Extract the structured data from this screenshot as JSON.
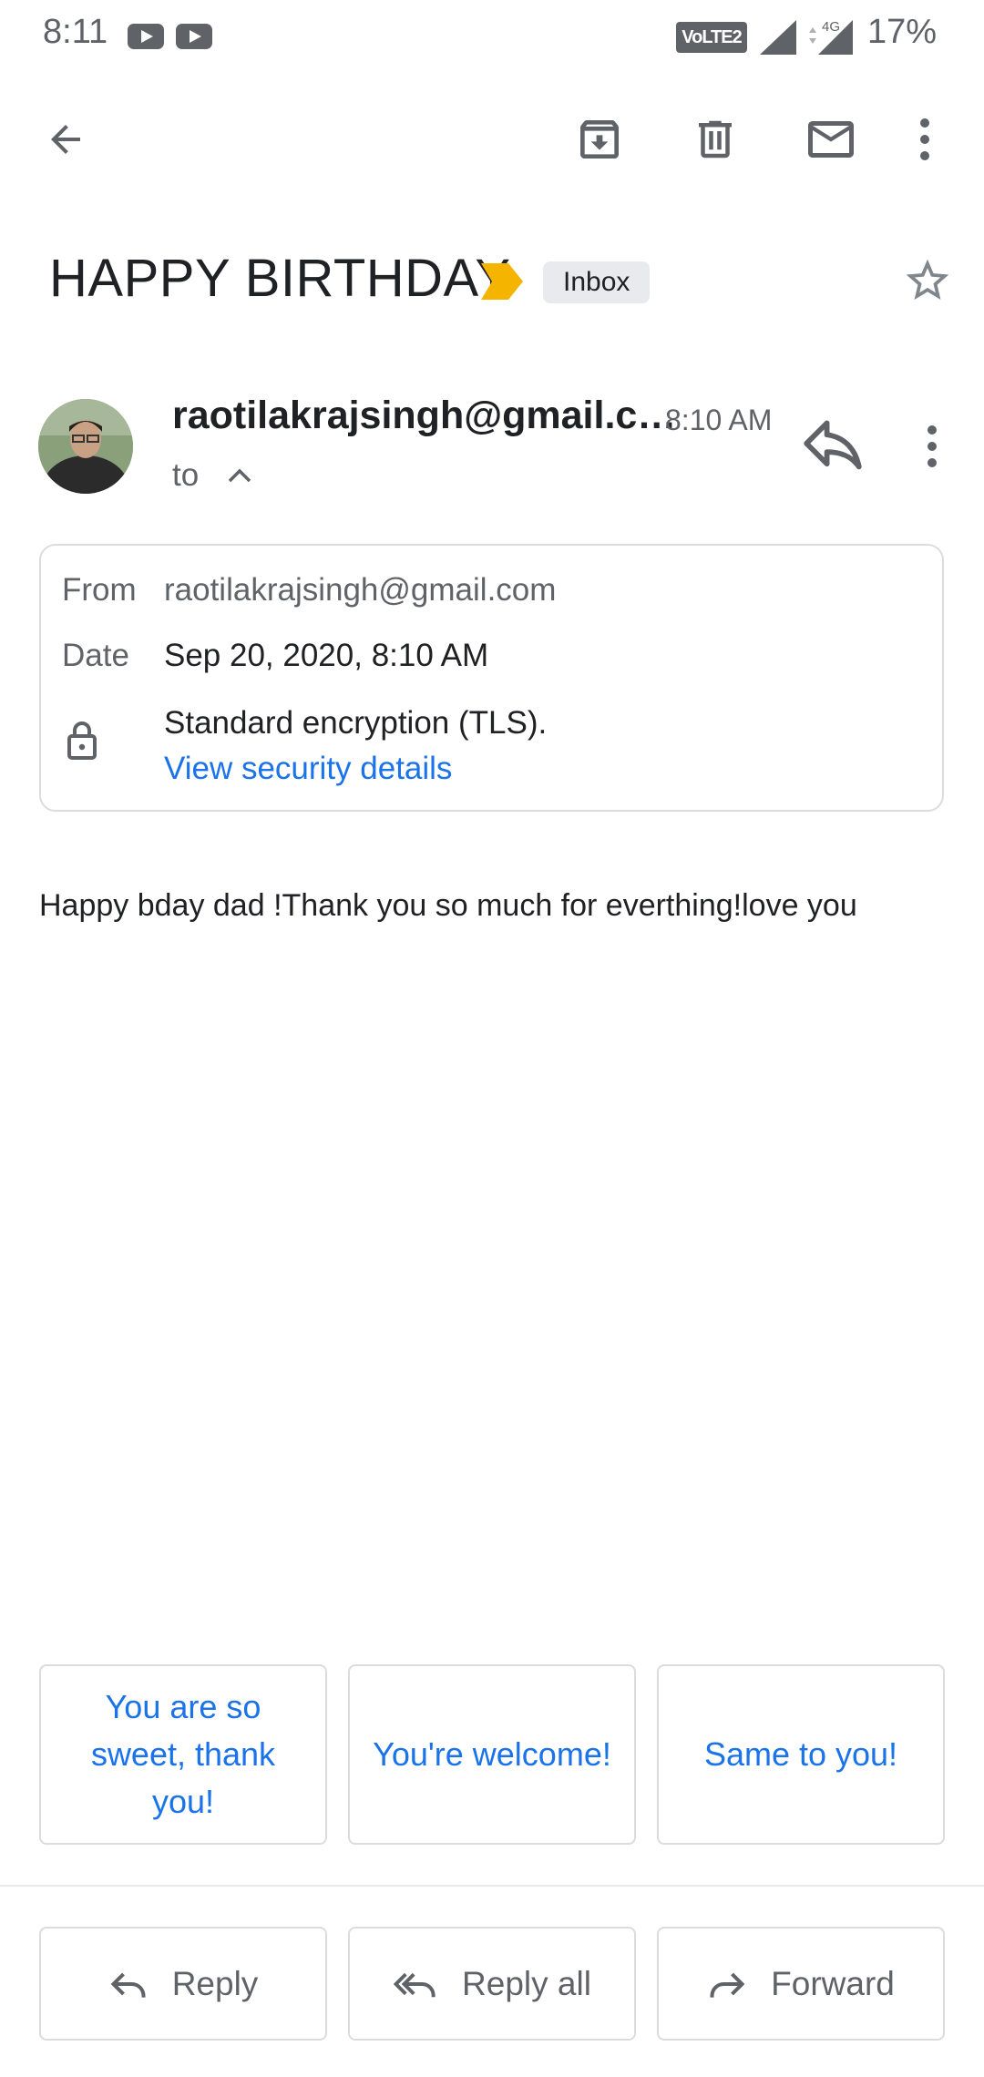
{
  "status_bar": {
    "time": "8:11",
    "network_badge": "VoLTE2",
    "network_type": "4G",
    "battery": "17%"
  },
  "email": {
    "subject": "HAPPY BIRTHDAY",
    "label": "Inbox",
    "sender": "raotilakrajsingh@gmail.c…",
    "time": "8:10 AM",
    "to_label": "to",
    "details": {
      "from_label": "From",
      "from_value": "raotilakrajsingh@gmail.com",
      "date_label": "Date",
      "date_value": "Sep 20, 2020, 8:10 AM",
      "encryption": "Standard encryption (TLS).",
      "security_link": "View security details"
    },
    "body": "Happy bday dad !Thank you so much for everthing!love you"
  },
  "smart_replies": [
    "You are so sweet, thank you!",
    "You're welcome!",
    "Same to you!"
  ],
  "actions": {
    "reply": "Reply",
    "reply_all": "Reply all",
    "forward": "Forward"
  },
  "colors": {
    "accent": "#1a73e8",
    "important_marker": "#f4b400",
    "icon_gray": "#5f6368"
  }
}
